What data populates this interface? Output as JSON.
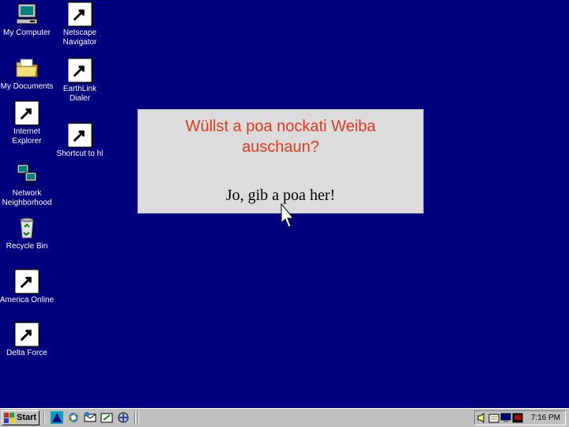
{
  "desktop_icons": [
    {
      "label": "My Computer"
    },
    {
      "label": "Netscape\nNavigator"
    },
    {
      "label": "My Documents"
    },
    {
      "label": "EarthLink\nDialer"
    },
    {
      "label": "Internet\nExplorer"
    },
    {
      "label": "Shortcut to hl"
    },
    {
      "label": "Network\nNeighborhood"
    },
    {
      "label": "Recycle Bin"
    },
    {
      "label": "America Online"
    },
    {
      "label": "Delta Force"
    }
  ],
  "prompt": {
    "question": "Wüllst a poa nockati Weiba auschaun?",
    "answer": "Jo, gib a poa her!"
  },
  "taskbar": {
    "start_label": "Start",
    "clock": "7:16 PM"
  },
  "colors": {
    "desktop": "#00007f",
    "question_text": "#e03a1e",
    "box": "#dcdcdc"
  }
}
